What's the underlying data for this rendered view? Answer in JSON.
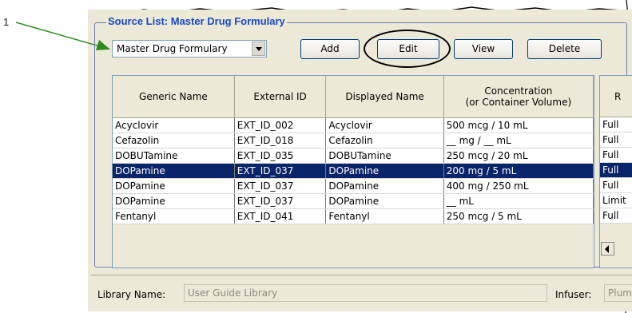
{
  "callout": {
    "number": "1"
  },
  "group": {
    "title": "Source List: Master Drug Formulary"
  },
  "source_select": {
    "value": "Master Drug Formulary"
  },
  "buttons": {
    "add": "Add",
    "edit": "Edit",
    "view": "View",
    "delete": "Delete"
  },
  "table": {
    "headers": {
      "generic": "Generic Name",
      "external": "External ID",
      "displayed": "Displayed Name",
      "conc_line1": "Concentration",
      "conc_line2": "(or Container Volume)",
      "r": "R"
    },
    "rows": [
      {
        "generic": "Acyclovir",
        "external": "EXT_ID_002",
        "displayed": "Acyclovir",
        "conc": "500 mcg / 10 mL",
        "r": "Full"
      },
      {
        "generic": "Cefazolin",
        "external": "EXT_ID_018",
        "displayed": "Cefazolin",
        "conc": "__ mg / __ mL",
        "r": "Full"
      },
      {
        "generic": "DOBUTamine",
        "external": "EXT_ID_035",
        "displayed": "DOBUTamine",
        "conc": "250 mcg / 20 mL",
        "r": "Full"
      },
      {
        "generic": "DOPamine",
        "external": "EXT_ID_037",
        "displayed": "DOPamine",
        "conc": "200 mg / 5 mL",
        "r": "Full"
      },
      {
        "generic": "DOPamine",
        "external": "EXT_ID_037",
        "displayed": "DOPamine",
        "conc": "400 mg / 250 mL",
        "r": "Full"
      },
      {
        "generic": "DOPamine",
        "external": "EXT_ID_037",
        "displayed": "DOPamine",
        "conc": "__ mL",
        "r": "Limit"
      },
      {
        "generic": "Fentanyl",
        "external": "EXT_ID_041",
        "displayed": "Fentanyl",
        "conc": "250 mcg / 5 mL",
        "r": "Full"
      }
    ]
  },
  "footer": {
    "library_label": "Library Name:",
    "library_value": "User Guide Library",
    "infuser_label": "Infuser:",
    "infuser_value": "Plum"
  },
  "colors": {
    "selection": "#0a246a",
    "group_title": "#1b48c4",
    "callout_arrow": "#2e8b22"
  }
}
